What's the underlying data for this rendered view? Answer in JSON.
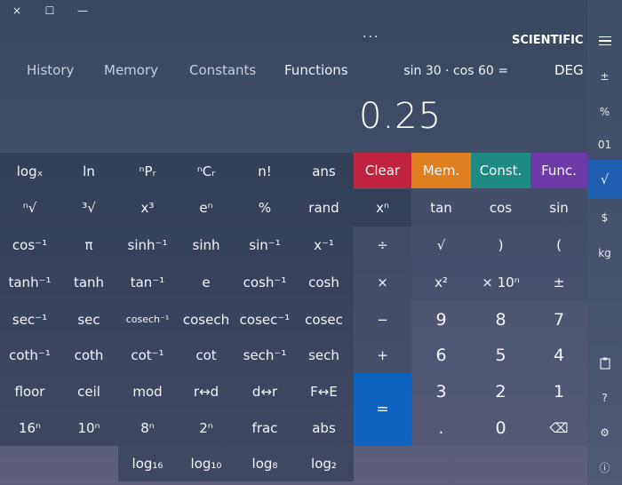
{
  "window": {
    "close": "×",
    "maximize": "☐",
    "minimize": "—"
  },
  "header": {
    "title": "SCIENTIFIC",
    "more": "···"
  },
  "modes": [
    "DEG",
    "Functions",
    "Constants",
    "Memory",
    "History"
  ],
  "expression": "sin 30 · cos 60 =",
  "display_value": "0.25",
  "sidebar": {
    "items": [
      {
        "label": "≡",
        "icon": "menu-icon"
      },
      {
        "label": "±"
      },
      {
        "label": "%"
      },
      {
        "label": "01"
      },
      {
        "label": "√"
      },
      {
        "label": "$"
      },
      {
        "label": "kg"
      },
      {
        "label": "📋",
        "icon": "clipboard-icon"
      },
      {
        "label": "?"
      },
      {
        "label": "⚙",
        "icon": "gear-icon"
      },
      {
        "label": "ⓘ",
        "icon": "info-icon"
      }
    ]
  },
  "colored": {
    "clear": "Clear",
    "mem": "Mem.",
    "const": "Const.",
    "func": "Func."
  },
  "top_row": [
    "ans",
    "n!",
    "ⁿCᵣ",
    "ⁿPᵣ",
    "ln",
    "logₓ"
  ],
  "row2": [
    "xⁿ",
    "rand",
    "%",
    "eⁿ",
    "x³",
    "³√",
    "ⁿ√",
    "tan",
    "cos",
    "sin"
  ],
  "row3": [
    "÷",
    "x⁻¹",
    "sin⁻¹",
    "sinh",
    "sinh⁻¹",
    "π",
    "cos⁻¹",
    "√",
    ")",
    "("
  ],
  "row4": [
    "×",
    "cosh",
    "cosh⁻¹",
    "e",
    "tan⁻¹",
    "tanh",
    "tanh⁻¹",
    "x²",
    "× 10ⁿ",
    "±"
  ],
  "row5": [
    "−",
    "cosec",
    "cosec⁻¹",
    "cosech",
    "cosech⁻¹",
    "sec",
    "sec⁻¹",
    "9",
    "8",
    "7"
  ],
  "row6": [
    "+",
    "sech",
    "sech⁻¹",
    "cot",
    "cot⁻¹",
    "coth",
    "coth⁻¹",
    "6",
    "5",
    "4"
  ],
  "row7": [
    "F↔E",
    "d↔r",
    "r↔d",
    "mod",
    "ceil",
    "floor",
    "3",
    "2",
    "1",
    "="
  ],
  "row8": [
    "abs",
    "frac",
    "2ⁿ",
    "8ⁿ",
    "10ⁿ",
    "16ⁿ",
    ".",
    "0",
    "⌫"
  ],
  "row9": [
    "log₂",
    "log₈",
    "log₁₀",
    "log₁₆"
  ]
}
